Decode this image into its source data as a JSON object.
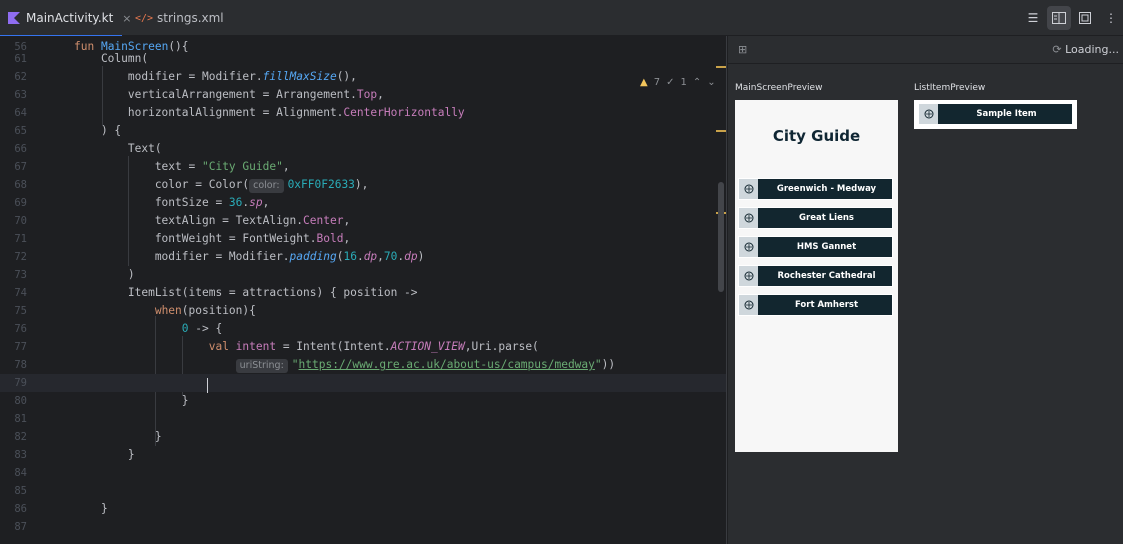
{
  "tabs": [
    {
      "label": "MainActivity.kt",
      "close": "×"
    },
    {
      "label": "strings.xml"
    }
  ],
  "inspections": {
    "warnings": "7",
    "weak_warnings": "1"
  },
  "code_lines": [
    {
      "n": "56",
      "tokens": [
        {
          "t": "fun ",
          "c": "kw"
        },
        {
          "t": "MainScreen",
          "c": "fn"
        },
        {
          "t": "(){",
          "c": "plain"
        }
      ]
    },
    {
      "n": "61",
      "tokens": [
        {
          "t": "    Column(",
          "c": "plain"
        }
      ]
    },
    {
      "n": "62",
      "tokens": [
        {
          "t": "        modifier = Modifier.",
          "c": "plain"
        },
        {
          "t": "fillMaxSize",
          "c": "fn it"
        },
        {
          "t": "(),",
          "c": "plain"
        }
      ]
    },
    {
      "n": "63",
      "tokens": [
        {
          "t": "        verticalArrangement = Arrangement.",
          "c": "plain"
        },
        {
          "t": "Top",
          "c": "prop"
        },
        {
          "t": ",",
          "c": "plain"
        }
      ]
    },
    {
      "n": "64",
      "tokens": [
        {
          "t": "        horizontalAlignment = Alignment.",
          "c": "plain"
        },
        {
          "t": "CenterHorizontally",
          "c": "prop"
        }
      ]
    },
    {
      "n": "65",
      "tokens": [
        {
          "t": "    ) {",
          "c": "plain"
        }
      ]
    },
    {
      "n": "66",
      "tokens": [
        {
          "t": "        Text(",
          "c": "plain"
        }
      ]
    },
    {
      "n": "67",
      "tokens": [
        {
          "t": "            text = ",
          "c": "plain"
        },
        {
          "t": "\"City Guide\"",
          "c": "str"
        },
        {
          "t": ",",
          "c": "plain"
        }
      ]
    },
    {
      "n": "68",
      "tokens": [
        {
          "t": "            color = Color(",
          "c": "plain"
        },
        {
          "t": "color:",
          "c": "hint"
        },
        {
          "t": "0xFF0F2633",
          "c": "num"
        },
        {
          "t": "),",
          "c": "plain"
        }
      ]
    },
    {
      "n": "69",
      "tokens": [
        {
          "t": "            fontSize = ",
          "c": "plain"
        },
        {
          "t": "36",
          "c": "num"
        },
        {
          "t": ".",
          "c": "plain"
        },
        {
          "t": "sp",
          "c": "prop it"
        },
        {
          "t": ",",
          "c": "plain"
        }
      ]
    },
    {
      "n": "70",
      "tokens": [
        {
          "t": "            textAlign = TextAlign.",
          "c": "plain"
        },
        {
          "t": "Center",
          "c": "prop"
        },
        {
          "t": ",",
          "c": "plain"
        }
      ]
    },
    {
      "n": "71",
      "tokens": [
        {
          "t": "            fontWeight = FontWeight.",
          "c": "plain"
        },
        {
          "t": "Bold",
          "c": "prop"
        },
        {
          "t": ",",
          "c": "plain"
        }
      ]
    },
    {
      "n": "72",
      "tokens": [
        {
          "t": "            modifier = Modifier.",
          "c": "plain"
        },
        {
          "t": "padding",
          "c": "fn it"
        },
        {
          "t": "(",
          "c": "plain"
        },
        {
          "t": "16",
          "c": "num"
        },
        {
          "t": ".",
          "c": "plain"
        },
        {
          "t": "dp",
          "c": "prop it"
        },
        {
          "t": ",",
          "c": "plain"
        },
        {
          "t": "70",
          "c": "num"
        },
        {
          "t": ".",
          "c": "plain"
        },
        {
          "t": "dp",
          "c": "prop it"
        },
        {
          "t": ")",
          "c": "plain"
        }
      ]
    },
    {
      "n": "73",
      "tokens": [
        {
          "t": "        )",
          "c": "plain"
        }
      ]
    },
    {
      "n": "74",
      "tokens": [
        {
          "t": "        ItemList(items = attractions) { position ->",
          "c": "plain"
        }
      ]
    },
    {
      "n": "75",
      "tokens": [
        {
          "t": "            ",
          "c": "plain"
        },
        {
          "t": "when",
          "c": "kw"
        },
        {
          "t": "(position){",
          "c": "plain"
        }
      ]
    },
    {
      "n": "76",
      "tokens": [
        {
          "t": "                ",
          "c": "plain"
        },
        {
          "t": "0",
          "c": "num"
        },
        {
          "t": " -> {",
          "c": "plain"
        }
      ]
    },
    {
      "n": "77",
      "tokens": [
        {
          "t": "                    ",
          "c": "plain"
        },
        {
          "t": "val ",
          "c": "kw"
        },
        {
          "t": "intent",
          "c": "prop"
        },
        {
          "t": " = Intent(Intent.",
          "c": "plain"
        },
        {
          "t": "ACTION_VIEW",
          "c": "prop it"
        },
        {
          "t": ",Uri.parse(",
          "c": "plain"
        }
      ]
    },
    {
      "n": "78",
      "tokens": [
        {
          "t": "                        ",
          "c": "plain"
        },
        {
          "t": "uriString:",
          "c": "hint"
        },
        {
          "t": "\"",
          "c": "str"
        },
        {
          "t": "https://www.gre.ac.uk/about-us/campus/medway",
          "c": "lnk"
        },
        {
          "t": "\"",
          "c": "str"
        },
        {
          "t": "))",
          "c": "plain"
        }
      ]
    },
    {
      "n": "79",
      "tokens": []
    },
    {
      "n": "80",
      "tokens": [
        {
          "t": "                }",
          "c": "plain"
        }
      ]
    },
    {
      "n": "81",
      "tokens": []
    },
    {
      "n": "82",
      "tokens": [
        {
          "t": "            }",
          "c": "plain"
        }
      ]
    },
    {
      "n": "83",
      "tokens": [
        {
          "t": "        }",
          "c": "plain"
        }
      ]
    },
    {
      "n": "84",
      "tokens": []
    },
    {
      "n": "85",
      "tokens": []
    },
    {
      "n": "86",
      "tokens": [
        {
          "t": "    }",
          "c": "plain"
        }
      ]
    },
    {
      "n": "87",
      "tokens": []
    }
  ],
  "preview": {
    "loading": "Loading...",
    "main_label": "MainScreenPreview",
    "list_label": "ListItemPreview",
    "city_title": "City Guide",
    "items": [
      "Greenwich - Medway",
      "Great Liens",
      "HMS Gannet",
      "Rochester Cathedral",
      "Fort Amherst"
    ],
    "sample_item": "Sample Item"
  }
}
